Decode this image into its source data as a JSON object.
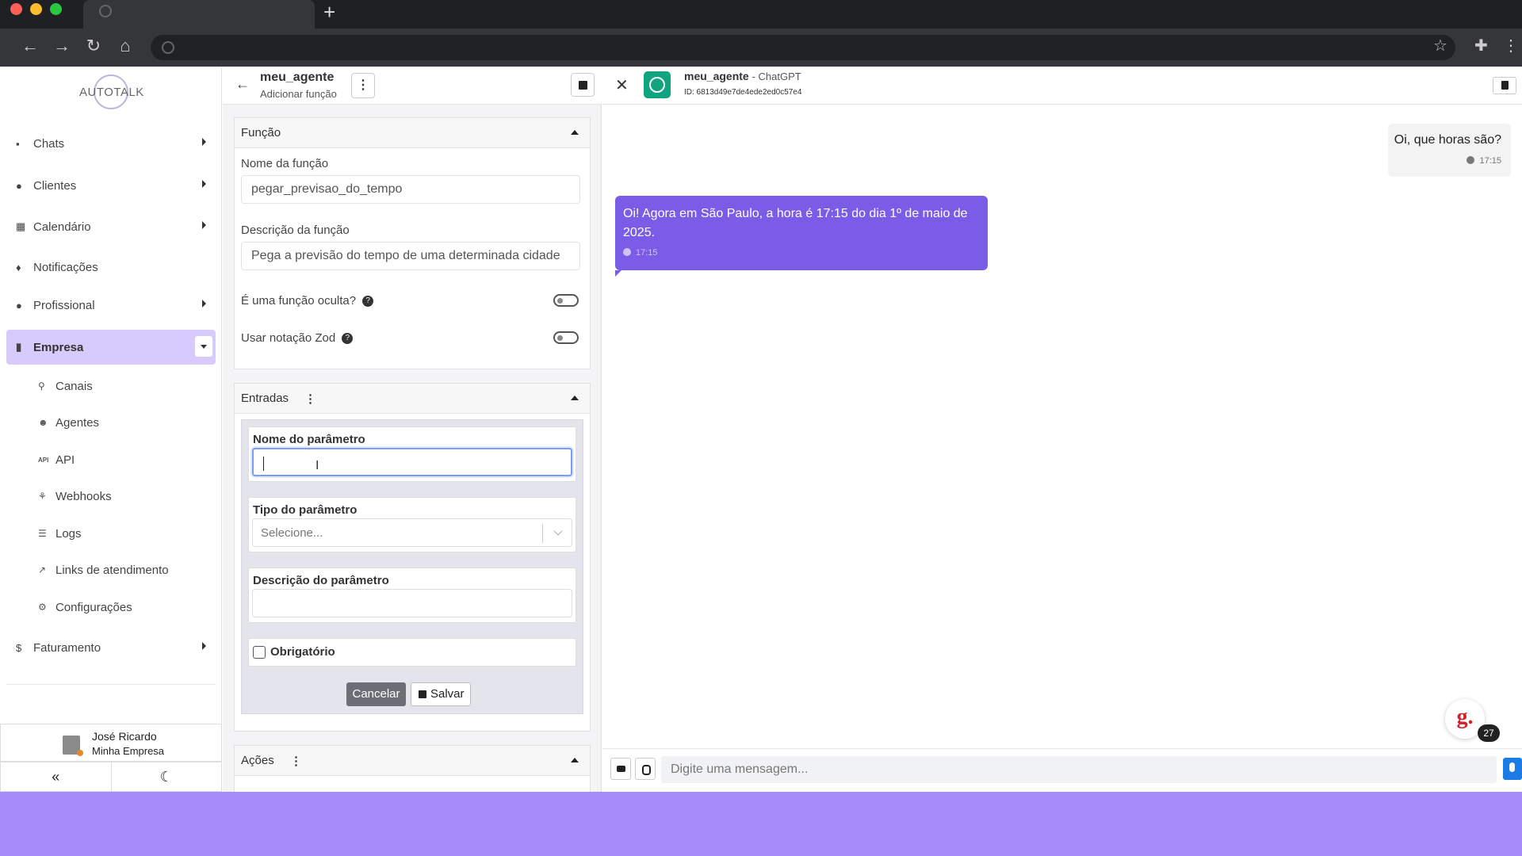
{
  "browser": {
    "new_tab": "+",
    "nav": {
      "back": "←",
      "forward": "→",
      "reload": "↻",
      "home": "⌂"
    },
    "right_icons": {
      "star": "☆",
      "extensions": "✚",
      "menu": "⋮"
    }
  },
  "brand": {
    "logo_text": "AUTOTALK"
  },
  "sidebar": {
    "items": [
      {
        "label": "Chats",
        "icon": "chat-icon",
        "glyph": "▪"
      },
      {
        "label": "Clientes",
        "icon": "users-icon",
        "glyph": "●"
      },
      {
        "label": "Calendário",
        "icon": "calendar-icon",
        "glyph": "▦"
      },
      {
        "label": "Notificações",
        "icon": "bell-icon",
        "glyph": "♦"
      },
      {
        "label": "Profissional",
        "icon": "user-tie-icon",
        "glyph": "●"
      },
      {
        "label": "Empresa",
        "icon": "building-icon",
        "glyph": "▮"
      }
    ],
    "sub_items": [
      {
        "label": "Canais",
        "icon": "rocket-icon",
        "glyph": "⚲"
      },
      {
        "label": "Agentes",
        "icon": "robot-icon",
        "glyph": "☻"
      },
      {
        "label": "API",
        "icon": "api-icon",
        "glyph": "API"
      },
      {
        "label": "Webhooks",
        "icon": "webhook-icon",
        "glyph": "⚘"
      },
      {
        "label": "Logs",
        "icon": "list-icon",
        "glyph": "☰"
      },
      {
        "label": "Links de atendimento",
        "icon": "external-link-icon",
        "glyph": "↗"
      },
      {
        "label": "Configurações",
        "icon": "gear-icon",
        "glyph": "⚙"
      }
    ],
    "billing": {
      "label": "Faturamento",
      "icon": "dollar-icon",
      "glyph": "$"
    },
    "user": {
      "name": "José Ricardo",
      "company": "Minha Empresa"
    },
    "collapse_glyph": "«",
    "theme_glyph": "☾"
  },
  "editor": {
    "title": "meu_agente",
    "subtitle": "Adicionar função",
    "back_glyph": "←",
    "kebab_glyph": "⋮",
    "funcao": {
      "header": "Função",
      "name_label": "Nome da função",
      "name_value": "pegar_previsao_do_tempo",
      "desc_label": "Descrição da função",
      "desc_value": "Pega a previsão do tempo de uma determinada cidade",
      "hidden_label": "É uma função oculta?",
      "zod_label": "Usar notação Zod",
      "help_glyph": "?"
    },
    "entradas": {
      "header": "Entradas",
      "param_name_label": "Nome do parâmetro",
      "param_name_value": "",
      "param_type_label": "Tipo do parâmetro",
      "param_type_placeholder": "Selecione...",
      "param_desc_label": "Descrição do parâmetro",
      "required_label": "Obrigatório",
      "cancel_label": "Cancelar",
      "save_label": "Salvar",
      "ibeam": "I"
    },
    "acoes": {
      "header": "Ações"
    }
  },
  "chat": {
    "close_glyph": "✕",
    "agent_name": "meu_agente",
    "provider": "- ChatGPT",
    "agent_id": "ID: 6813d49e7de4ede2ed0c57e4",
    "messages": [
      {
        "text": "Oi, que horas são?",
        "time": "17:15",
        "direction": "outgoing"
      },
      {
        "text": "Oi! Agora em São Paulo, a hora é 17:15 do dia 1º de maio de 2025.",
        "time": "17:15",
        "direction": "incoming"
      }
    ],
    "input_placeholder": "Digite uma mensagem...",
    "widget_letter": "g.",
    "widget_badge": "27",
    "colors": {
      "incoming_bubble": "#7b5ce6",
      "outgoing_bubble": "#f3f3f3",
      "accent": "#a78bfa"
    }
  }
}
